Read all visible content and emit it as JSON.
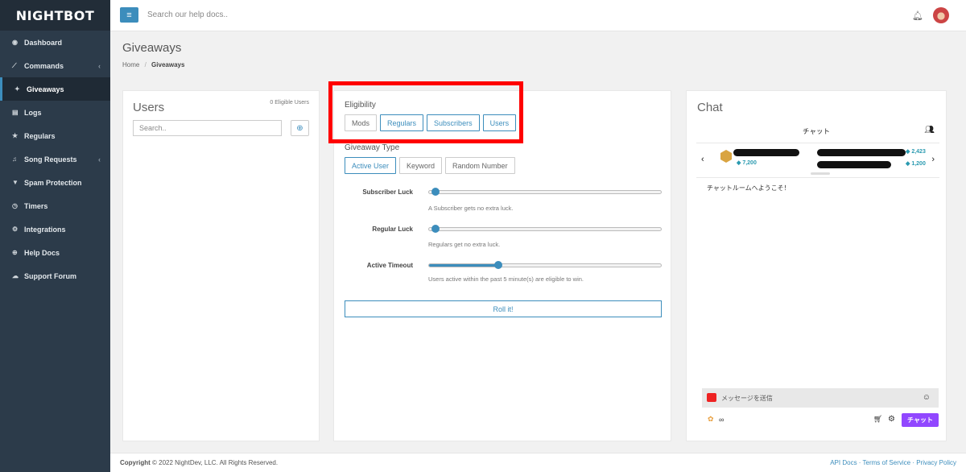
{
  "brand": {
    "logo": "NIGHTBOT"
  },
  "sidebar": {
    "items": [
      {
        "label": "Dashboard",
        "icon": "dashboard-icon",
        "glyph": "◉",
        "chev": ""
      },
      {
        "label": "Commands",
        "icon": "terminal-icon",
        "glyph": "⟋",
        "chev": "‹"
      },
      {
        "label": "Giveaways",
        "icon": "gift-icon",
        "glyph": "✦",
        "chev": ""
      },
      {
        "label": "Logs",
        "icon": "logs-icon",
        "glyph": "▤",
        "chev": ""
      },
      {
        "label": "Regulars",
        "icon": "star-icon",
        "glyph": "★",
        "chev": ""
      },
      {
        "label": "Song Requests",
        "icon": "music-icon",
        "glyph": "♫",
        "chev": "‹"
      },
      {
        "label": "Spam Protection",
        "icon": "filter-icon",
        "glyph": "▼",
        "chev": ""
      },
      {
        "label": "Timers",
        "icon": "clock-icon",
        "glyph": "◷",
        "chev": ""
      },
      {
        "label": "Integrations",
        "icon": "integrations-icon",
        "glyph": "⚙",
        "chev": ""
      },
      {
        "label": "Help Docs",
        "icon": "globe-icon",
        "glyph": "⊕",
        "chev": ""
      },
      {
        "label": "Support Forum",
        "icon": "comments-icon",
        "glyph": "☁",
        "chev": ""
      }
    ]
  },
  "topbar": {
    "search_placeholder": "Search our help docs.."
  },
  "header": {
    "title": "Giveaways",
    "breadcrumb_home": "Home",
    "breadcrumb_sep": "/",
    "breadcrumb_current": "Giveaways"
  },
  "users": {
    "title": "Users",
    "eligible": "0 Eligible Users",
    "search_placeholder": "Search.."
  },
  "settings": {
    "eligibility_label": "Eligibility",
    "eligibility": [
      "Mods",
      "Regulars",
      "Subscribers",
      "Users"
    ],
    "giveaway_type_label": "Giveaway Type",
    "giveaway_types": [
      "Active User",
      "Keyword",
      "Random Number"
    ],
    "sliders": [
      {
        "label": "Subscriber Luck",
        "help": "A Subscriber gets no extra luck.",
        "value": 0
      },
      {
        "label": "Regular Luck",
        "help": "Regulars get no extra luck.",
        "value": 0
      },
      {
        "label": "Active Timeout",
        "help": "Users active within the past 5 minute(s) are eligible to win.",
        "value": 0.3
      }
    ],
    "roll_label": "Roll it!"
  },
  "chat": {
    "title": "Chat",
    "header": "チャット",
    "leader_points": "7,200",
    "right_points_1": "2,423",
    "right_points_2": "1,200",
    "welcome": "チャットルームへようこそ！",
    "input_placeholder": "メッセージを送信",
    "infinity": "∞",
    "send_label": "チャット"
  },
  "footer": {
    "copy_bold": "Copyright",
    "copy_rest": "© 2022 NightDev, LLC. All Rights Reserved.",
    "links": "API Docs · Terms of Service · Privacy Policy"
  }
}
